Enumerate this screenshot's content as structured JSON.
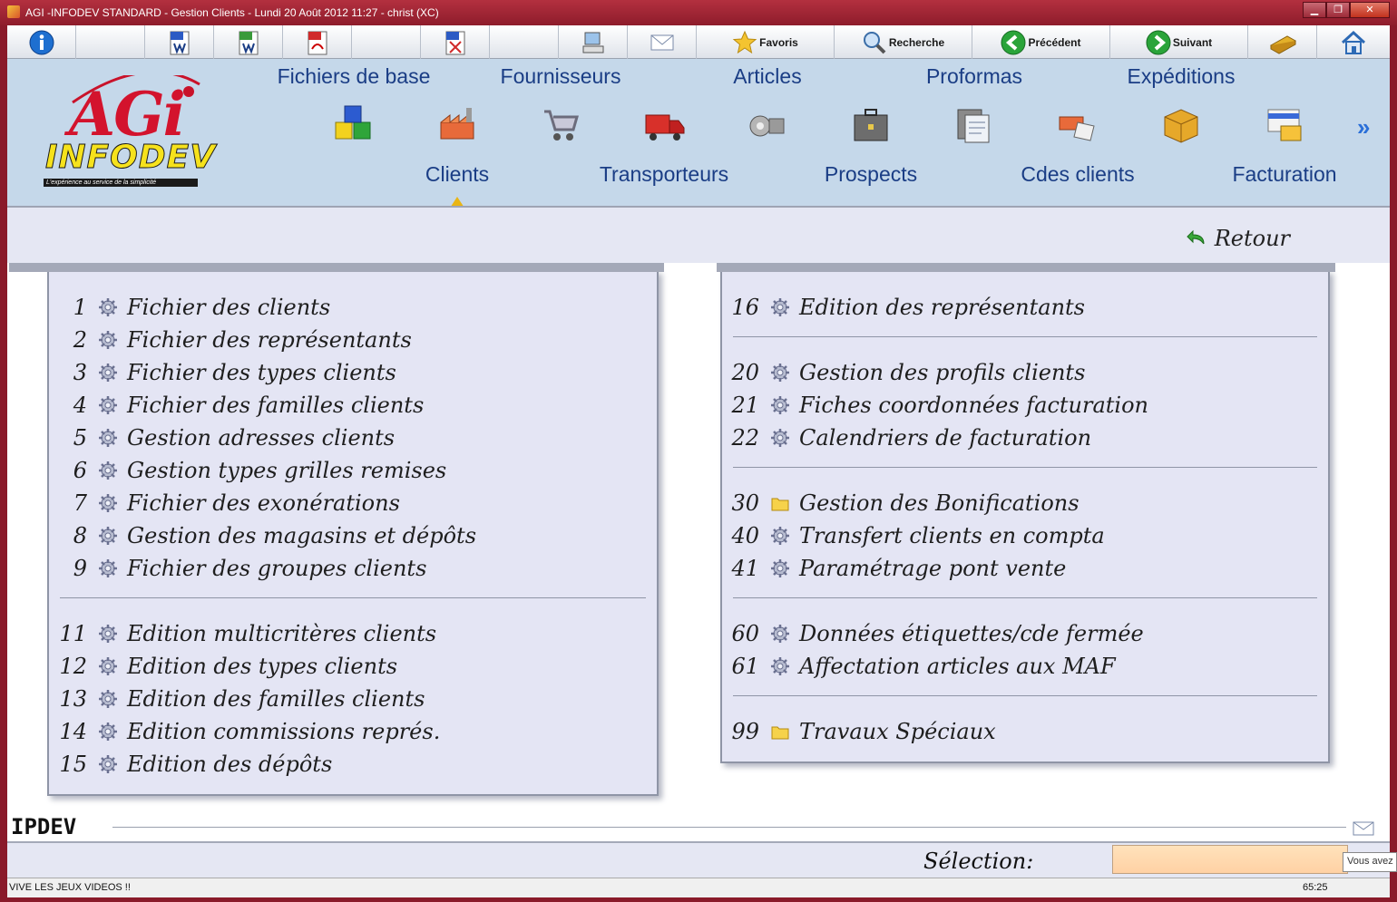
{
  "window": {
    "title": "AGI -INFODEV STANDARD - Gestion Clients - Lundi 20 Août 2012 11:27 - christ (XC)",
    "min_label": "▁",
    "max_label": "❐",
    "close_label": "✕"
  },
  "toolbar": {
    "favoris": "Favoris",
    "recherche": "Recherche",
    "precedent": "Précédent",
    "suivant": "Suivant"
  },
  "logo": {
    "agi": "AGi",
    "infodev": "INFODEV",
    "tagline": "L'expérience au service de la simplicité"
  },
  "nav": {
    "top": [
      "Fichiers de base",
      "Fournisseurs",
      "Articles",
      "Proformas",
      "Expéditions"
    ],
    "bottom": [
      "Clients",
      "Transporteurs",
      "Prospects",
      "Cdes clients",
      "Facturation"
    ],
    "next_label": "»"
  },
  "subbar": {
    "retour": "Retour"
  },
  "left_menu": [
    {
      "num": "1",
      "label": "Fichier des clients",
      "icon": "gear-icon"
    },
    {
      "num": "2",
      "label": "Fichier des représentants",
      "icon": "gear-icon"
    },
    {
      "num": "3",
      "label": "Fichier des types clients",
      "icon": "gear-icon"
    },
    {
      "num": "4",
      "label": "Fichier des familles clients",
      "icon": "gear-icon"
    },
    {
      "num": "5",
      "label": "Gestion adresses clients",
      "icon": "gear-icon"
    },
    {
      "num": "6",
      "label": "Gestion types grilles remises",
      "icon": "gear-icon"
    },
    {
      "num": "7",
      "label": "Fichier des exonérations",
      "icon": "gear-icon"
    },
    {
      "num": "8",
      "label": "Gestion des magasins et dépôts",
      "icon": "gear-icon"
    },
    {
      "num": "9",
      "label": "Fichier des groupes clients",
      "icon": "gear-icon"
    },
    {
      "num": "11",
      "label": "Edition multicritères clients",
      "icon": "gear-icon"
    },
    {
      "num": "12",
      "label": "Edition des types clients",
      "icon": "gear-icon"
    },
    {
      "num": "13",
      "label": "Edition des familles clients",
      "icon": "gear-icon"
    },
    {
      "num": "14",
      "label": "Edition commissions représ.",
      "icon": "gear-icon"
    },
    {
      "num": "15",
      "label": "Edition des dépôts",
      "icon": "gear-icon"
    }
  ],
  "right_menu": [
    {
      "num": "16",
      "label": "Edition des représentants",
      "icon": "gear-icon"
    },
    {
      "num": "20",
      "label": "Gestion des profils clients",
      "icon": "gear-icon"
    },
    {
      "num": "21",
      "label": "Fiches coordonnées facturation",
      "icon": "gear-icon"
    },
    {
      "num": "22",
      "label": "Calendriers de facturation",
      "icon": "gear-icon"
    },
    {
      "num": "30",
      "label": "Gestion des Bonifications",
      "icon": "folder-icon"
    },
    {
      "num": "40",
      "label": "Transfert clients en compta",
      "icon": "gear-icon"
    },
    {
      "num": "41",
      "label": "Paramétrage pont vente",
      "icon": "gear-icon"
    },
    {
      "num": "60",
      "label": "Données étiquettes/cde fermée",
      "icon": "gear-icon"
    },
    {
      "num": "61",
      "label": "Affectation articles aux MAF",
      "icon": "gear-icon"
    },
    {
      "num": "99",
      "label": "Travaux Spéciaux",
      "icon": "folder-icon"
    }
  ],
  "bottom": {
    "ipdev": "IPDEV",
    "selection_label": "Sélection:",
    "selection_value": "",
    "tooltip": "Vous avez",
    "status_left": "VIVE LES JEUX VIDEOS !!",
    "status_right": "65:25"
  },
  "colors": {
    "title_bar": "#9b2433",
    "nav_bg": "#c5d8ea",
    "nav_text": "#1a3d85",
    "panel_bg": "#e4e5f4",
    "selection_bg": "#ffd9b0"
  }
}
